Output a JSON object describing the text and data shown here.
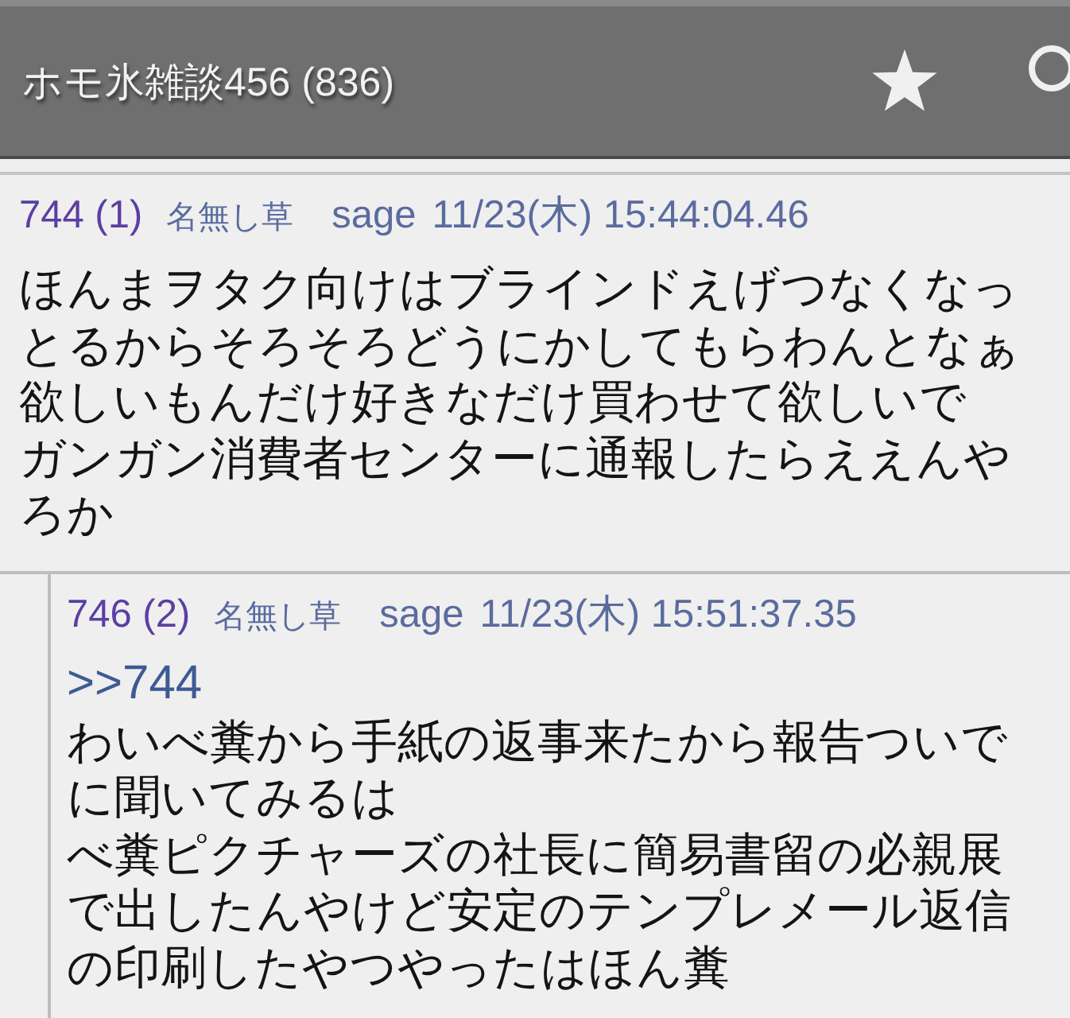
{
  "header": {
    "title": "ホモ氷雑談456 (836)"
  },
  "posts": [
    {
      "id": "744 (1)",
      "name": "名無し草",
      "mail": "sage",
      "date": "11/23(木) 15:44:04.46",
      "lines": [
        "ほんまヲタク向けはブラインドえげつなくなっとるからそろそろどうにかしてもらわんとなぁ",
        "欲しいもんだけ好きなだけ買わせて欲しいで",
        "ガンガン消費者センターに通報したらええんやろか"
      ],
      "children": [
        {
          "id": "746 (2)",
          "name": "名無し草",
          "mail": "sage",
          "date": "11/23(木) 15:51:37.35",
          "anchor": ">>744",
          "lines": [
            "わいべ糞から手紙の返事来たから報告ついでに聞いてみるは",
            "べ糞ピクチャーズの社長に簡易書留の必親展で出したんやけど安定のテンプレメール返信の印刷したやつやったはほん糞"
          ]
        }
      ]
    }
  ]
}
